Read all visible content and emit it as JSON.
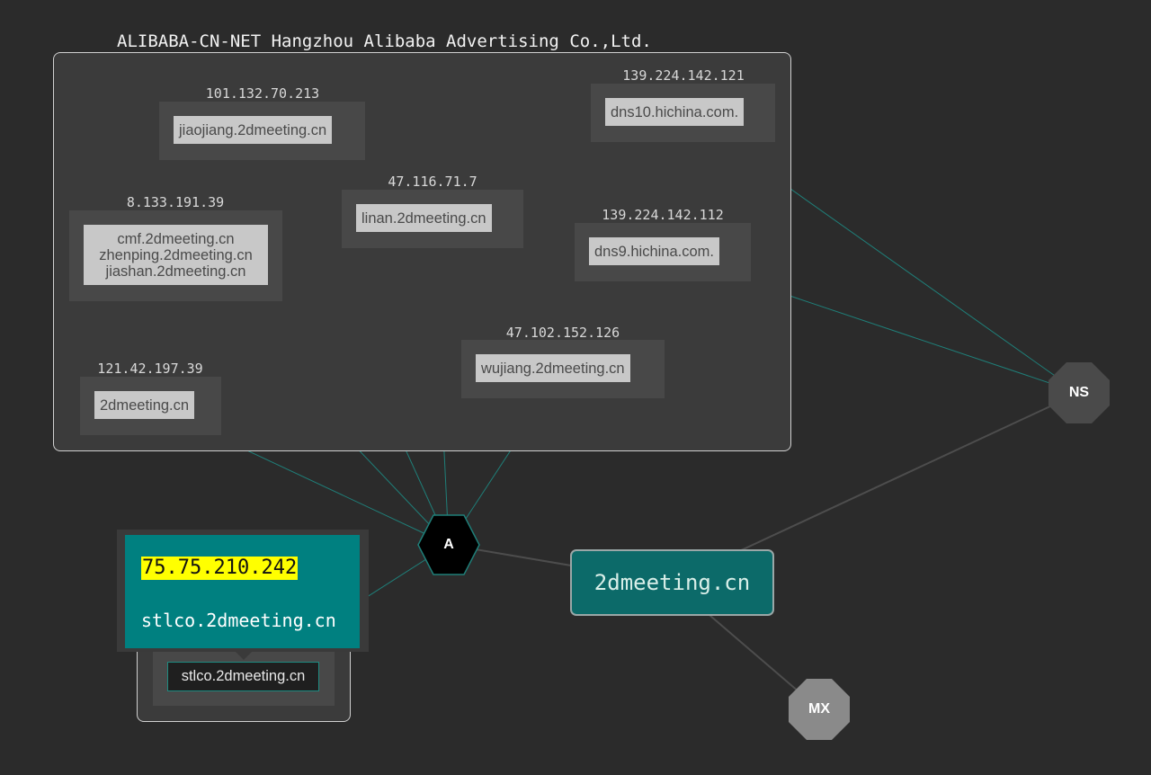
{
  "cluster": {
    "title": "ALIBABA-CN-NET Hangzhou Alibaba Advertising Co.,Ltd."
  },
  "hosts": [
    {
      "ip": "101.132.70.213",
      "names": [
        "jiaojiang.2dmeeting.cn"
      ]
    },
    {
      "ip": "139.224.142.121",
      "names": [
        "dns10.hichina.com."
      ]
    },
    {
      "ip": "8.133.191.39",
      "names": [
        "cmf.2dmeeting.cn",
        "zhenping.2dmeeting.cn",
        "jiashan.2dmeeting.cn"
      ]
    },
    {
      "ip": "47.116.71.7",
      "names": [
        "linan.2dmeeting.cn"
      ]
    },
    {
      "ip": "139.224.142.112",
      "names": [
        "dns9.hichina.com."
      ]
    },
    {
      "ip": "47.102.152.126",
      "names": [
        "wujiang.2dmeeting.cn"
      ]
    },
    {
      "ip": "121.42.197.39",
      "names": [
        "2dmeeting.cn"
      ]
    }
  ],
  "record_hubs": {
    "a": "A",
    "ns": "NS",
    "mx": "MX"
  },
  "domain": "2dmeeting.cn",
  "tooltip": {
    "ip": "75.75.210.242",
    "host": "stlco.2dmeeting.cn"
  },
  "selected_host": {
    "name": "stlco.2dmeeting.cn"
  },
  "colors": {
    "background": "#2b2b2b",
    "edge_record": "#1f7f79",
    "edge_hub": "#4d4d4d",
    "domain_fill": "#0c6a69",
    "tooltip_fill": "#008080",
    "ip_highlight": "#ffff00"
  }
}
